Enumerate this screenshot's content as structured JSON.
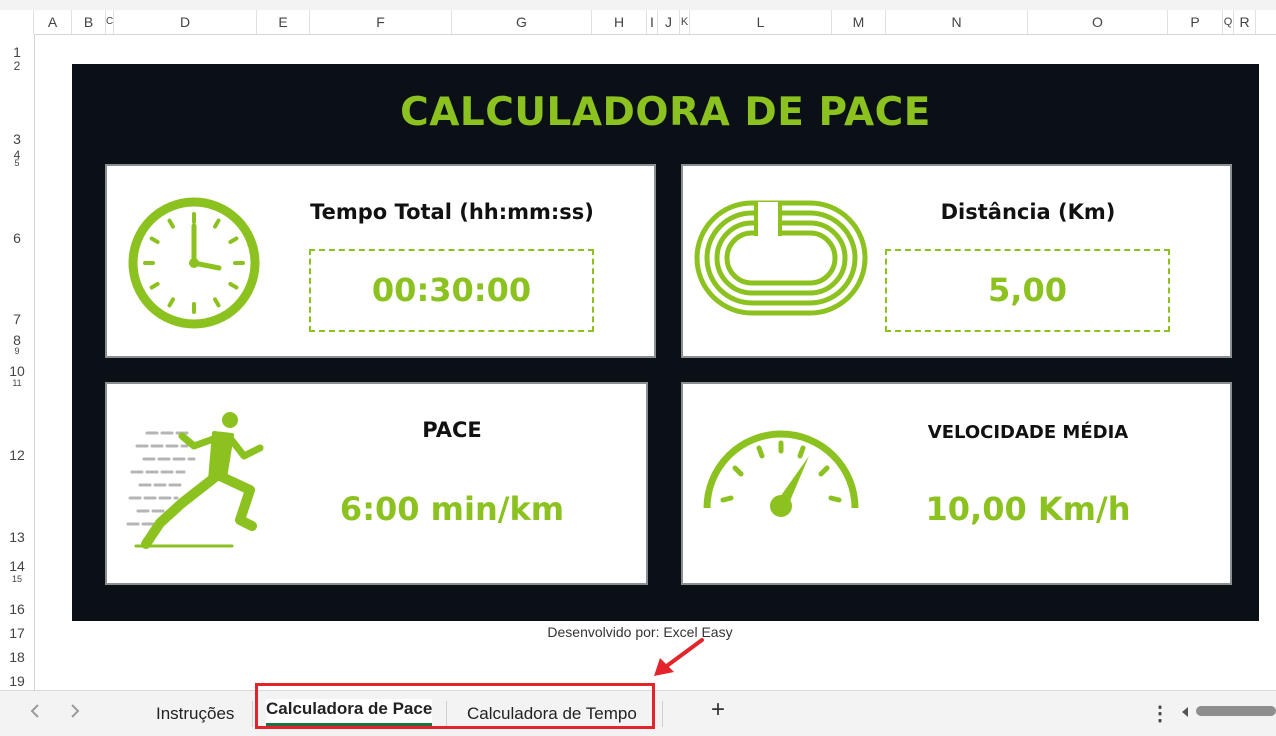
{
  "columns": [
    "A",
    "B",
    "C",
    "D",
    "E",
    "F",
    "G",
    "H",
    "I",
    "J",
    "K",
    "L",
    "M",
    "N",
    "O",
    "P",
    "Q",
    "R"
  ],
  "rows": [
    "1",
    "2",
    "3",
    "4",
    "5",
    "6",
    "7",
    "8",
    "9",
    "10",
    "11",
    "12",
    "13",
    "14",
    "15",
    "16",
    "17",
    "18",
    "19"
  ],
  "dashboard": {
    "title": "CALCULADORA DE PACE",
    "time_card": {
      "label": "Tempo Total (hh:mm:ss)",
      "value": "00:30:00"
    },
    "distance_card": {
      "label": "Distância (Km)",
      "value": "5,00"
    },
    "pace_card": {
      "label": "PACE",
      "value": "6:00 min/km"
    },
    "speed_card": {
      "label": "VELOCIDADE MÉDIA",
      "value": "10,00 Km/h"
    },
    "accent_color": "#8cc21f",
    "background_color": "#0b1017"
  },
  "credit": "Desenvolvido por: Excel Easy",
  "sheet_tabs": {
    "prev_icon": "chevron-left-icon",
    "next_icon": "chevron-right-icon",
    "tabs": [
      {
        "label": "Instruções",
        "active": false
      },
      {
        "label": "Calculadora de Pace",
        "active": true
      },
      {
        "label": "Calculadora de Tempo",
        "active": false
      }
    ],
    "add_label": "+",
    "more_label": "⋮"
  }
}
